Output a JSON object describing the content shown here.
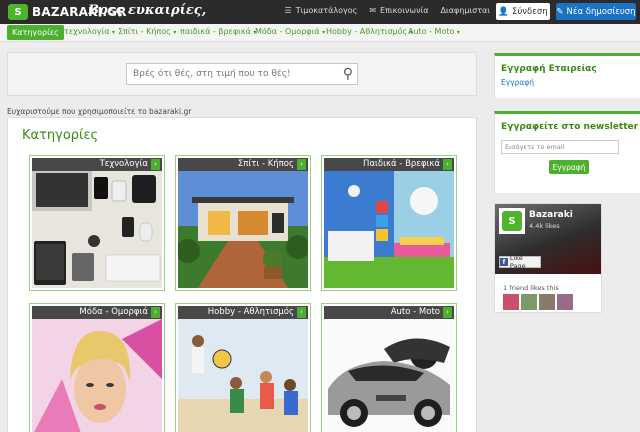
{
  "header": {
    "logo_text": "BAZARAKI.GR",
    "slogan": "Βρες ευκαιρίες,",
    "links": [
      {
        "label": "Τιμοκατάλογος",
        "icon": "list-icon"
      },
      {
        "label": "Επικοινωνία",
        "icon": "envelope-icon"
      },
      {
        "label": "Διαφημισται",
        "icon": "none"
      }
    ],
    "login_label": "Σύνδεση",
    "new_ad_label": "Νέα δημοσίευση"
  },
  "nav": {
    "items": [
      {
        "label": "Κατηγορίες",
        "active": true
      },
      {
        "label": "τεχνολογία"
      },
      {
        "label": "Σπίτι - Κήπος"
      },
      {
        "label": "παιδικά - βρεφικά"
      },
      {
        "label": "Μόδα - Ομορφιά"
      },
      {
        "label": "Hobby - Αθλητισμός"
      },
      {
        "label": "Auto - Moto"
      }
    ]
  },
  "search": {
    "placeholder": "Βρές ότι θές, στη τιμή που το θές!"
  },
  "thanks_text": "Ευχαριστούμε που χρησιμοποιείτε το bazaraki.gr",
  "categories": {
    "title": "Κατηγορίες",
    "tiles": [
      {
        "label": "Τεχνολογία",
        "art": "tech"
      },
      {
        "label": "Σπίτι - Κήπος",
        "art": "house"
      },
      {
        "label": "Παιδικά - Βρεφικά",
        "art": "kids"
      },
      {
        "label": "Μόδα - Ομορφιά",
        "art": "fashion"
      },
      {
        "label": "Hobby - Αθλητισμός",
        "art": "hobby"
      },
      {
        "label": "Auto - Moto",
        "art": "auto"
      }
    ]
  },
  "sidebar": {
    "company": {
      "title": "Εγγραφή Εταιρείας",
      "link": "Εγγραφή"
    },
    "newsletter": {
      "title": "Εγγραφείτε στο newsletter μας",
      "email_placeholder": "Εισάγετε το email",
      "button": "Εγγραφή"
    },
    "facebook": {
      "page_name": "Bazaraki",
      "likes": "4.4k likes",
      "like_button": "Like Page",
      "friends_text": "1 friend likes this"
    }
  },
  "colors": {
    "brand_green": "#4caf30",
    "accent_blue": "#1a73c4",
    "topbar": "#2b2b2b"
  }
}
